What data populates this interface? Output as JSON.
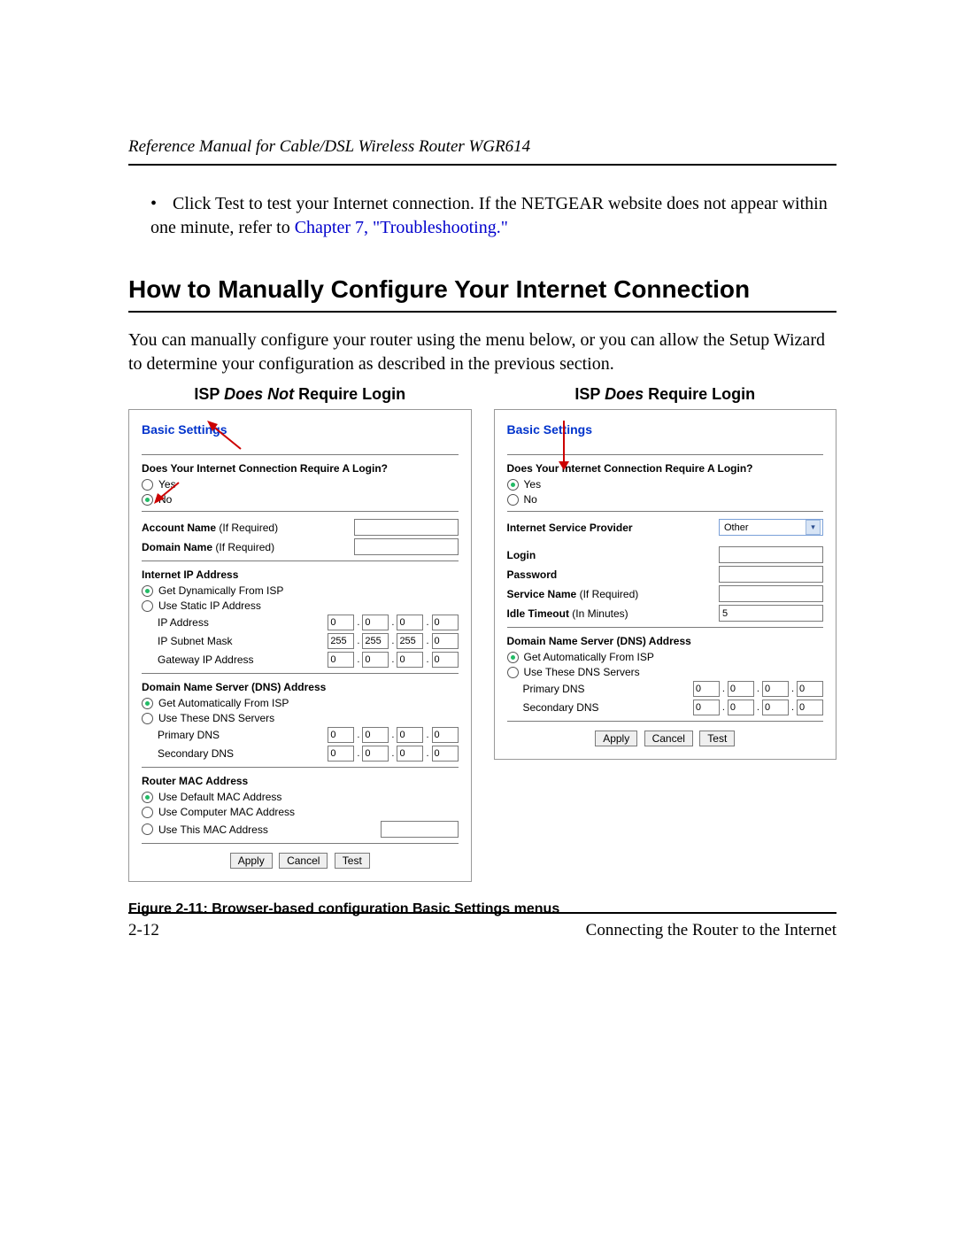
{
  "header": {
    "running": "Reference Manual for Cable/DSL Wireless Router WGR614"
  },
  "bullet": {
    "text_a": "Click Test to test your Internet connection. If the NETGEAR website does not appear within one minute, refer to ",
    "link": "Chapter 7, \"Troubleshooting.\"",
    "text_b": ""
  },
  "section_title": "How to Manually Configure Your Internet Connection",
  "intro": "You can manually configure your router using the menu below, or you can allow the Setup Wizard to determine your configuration as described in the previous section.",
  "col_titles": {
    "left_prefix": "ISP ",
    "left_em": "Does Not",
    "left_suffix": " Require Login",
    "right_prefix": "ISP ",
    "right_em": "Does",
    "right_suffix": " Require Login"
  },
  "left_panel": {
    "title": "Basic Settings",
    "q": "Does Your Internet Connection Require A Login?",
    "yes": "Yes",
    "no": "No",
    "account_name": "Account Name",
    "if_req": "(If Required)",
    "domain_name": "Domain Name",
    "ip_hdr": "Internet IP Address",
    "ip_dyn": "Get Dynamically From ISP",
    "ip_static": "Use Static IP Address",
    "ip_label": "IP Address",
    "subnet_label": "IP Subnet Mask",
    "gw_label": "Gateway IP Address",
    "ip_addr": [
      "0",
      "0",
      "0",
      "0"
    ],
    "subnet": [
      "255",
      "255",
      "255",
      "0"
    ],
    "gateway": [
      "0",
      "0",
      "0",
      "0"
    ],
    "dns_hdr": "Domain Name Server (DNS) Address",
    "dns_auto": "Get Automatically From ISP",
    "dns_use": "Use These DNS Servers",
    "pdns_label": "Primary DNS",
    "sdns_label": "Secondary DNS",
    "pdns": [
      "0",
      "0",
      "0",
      "0"
    ],
    "sdns": [
      "0",
      "0",
      "0",
      "0"
    ],
    "mac_hdr": "Router MAC Address",
    "mac_default": "Use Default MAC Address",
    "mac_computer": "Use Computer MAC Address",
    "mac_this": "Use This MAC Address",
    "mac_value": "",
    "apply": "Apply",
    "cancel": "Cancel",
    "test": "Test"
  },
  "right_panel": {
    "title": "Basic Settings",
    "q": "Does Your Internet Connection Require A Login?",
    "yes": "Yes",
    "no": "No",
    "isp_label": "Internet Service Provider",
    "isp_value": "Other",
    "login_label": "Login",
    "password_label": "Password",
    "service_label": "Service Name",
    "if_req": "(If Required)",
    "idle_label": "Idle Timeout",
    "idle_hint": "(In Minutes)",
    "idle_value": "5",
    "dns_hdr": "Domain Name Server (DNS) Address",
    "dns_auto": "Get Automatically From ISP",
    "dns_use": "Use These DNS Servers",
    "pdns_label": "Primary DNS",
    "sdns_label": "Secondary DNS",
    "pdns": [
      "0",
      "0",
      "0",
      "0"
    ],
    "sdns": [
      "0",
      "0",
      "0",
      "0"
    ],
    "apply": "Apply",
    "cancel": "Cancel",
    "test": "Test"
  },
  "figure_caption": "Figure 2-11:  Browser-based configuration Basic Settings menus",
  "footer": {
    "left": "2-12",
    "right": "Connecting the Router to the Internet"
  }
}
